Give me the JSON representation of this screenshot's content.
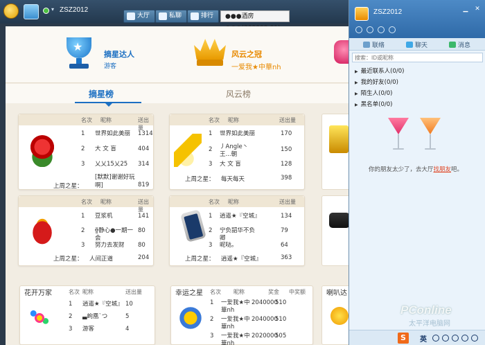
{
  "topbar": {
    "username": "ZSZ2012",
    "nav": {
      "hall": "大厅",
      "chat": "私聊",
      "rank": "排行"
    },
    "room": "●●●酒房●●●(209009-01)"
  },
  "hero": {
    "title1": "摘星达人",
    "sub1": "游客",
    "title2": "风云之冠",
    "sub2": "一爱我★中華nh"
  },
  "tabs": {
    "star": "摘星榜",
    "wind": "风云榜"
  },
  "headers": {
    "rank": "名次",
    "nick": "昵称",
    "out": "送出量",
    "award": "奖金",
    "win": "中奖额"
  },
  "prev_label": "上周之星：",
  "cards": [
    {
      "rows": [
        {
          "rank": "1",
          "nick": "世界如此美丽",
          "val": "1314"
        },
        {
          "rank": "2",
          "nick": "大 文 盲",
          "val": "404"
        },
        {
          "rank": "3",
          "nick": "乂乂15乂25",
          "val": "314"
        }
      ],
      "prev_nick": "[默默]谢谢好玩啊]",
      "prev_val": "819"
    },
    {
      "rows": [
        {
          "rank": "1",
          "nick": "世界如此美丽",
          "val": "170"
        },
        {
          "rank": "2",
          "nick": "丿Angle丶王...朝",
          "val": "150"
        },
        {
          "rank": "3",
          "nick": "大 文 盲",
          "val": "128"
        }
      ],
      "prev_nick": "每天每天",
      "prev_val": "398"
    },
    {
      "rows": [
        {
          "rank": "1",
          "nick": "豆浆机",
          "val": "141"
        },
        {
          "rank": "2",
          "nick": "╬静心●一期一会",
          "val": "80"
        },
        {
          "rank": "3",
          "nick": "努力去发财",
          "val": "80"
        }
      ],
      "prev_nick": "人间正道",
      "prev_val": "204"
    },
    {
      "rows": [
        {
          "rank": "1",
          "nick": "逍遥★『空城』",
          "val": "134"
        },
        {
          "rank": "2",
          "nick": "宁负韶华不负卿",
          "val": "79"
        },
        {
          "rank": "3",
          "nick": "昵哒。",
          "val": "64"
        }
      ],
      "prev_nick": "逍遥★『空城』",
      "prev_val": "363"
    },
    {
      "title": "花开万家",
      "rows": [
        {
          "rank": "1",
          "nick": "逍遥★『空城』",
          "val": "10"
        },
        {
          "rank": "2",
          "nick": "▃岣凰ˋつ",
          "val": "5"
        },
        {
          "rank": "3",
          "nick": "游客",
          "val": "4"
        }
      ]
    },
    {
      "title": "幸运之星",
      "rows": [
        {
          "rank": "1",
          "nick": "一爱我★中華nh",
          "val": "2040000",
          "val2": "510"
        },
        {
          "rank": "2",
          "nick": "一爱我★中華nh",
          "val": "2040000",
          "val2": "510"
        },
        {
          "rank": "3",
          "nick": "一爱我★中華nh",
          "val": "2020000",
          "val2": "505"
        }
      ]
    },
    {
      "title": "喇叭达"
    }
  ],
  "im": {
    "name": "ZSZ2012",
    "tabs": {
      "contacts": "联络",
      "chat": "聊天",
      "msg": "消息"
    },
    "search_placeholder": "搜索：ID或昵称",
    "groups": [
      "最近联系人(0/0)",
      "我的好友(0/0)",
      "陌生人(0/0)",
      "黑名单(0/0)"
    ],
    "tip_prefix": "你的朋友太少了，去大厅",
    "tip_link": "找朋友",
    "tip_suffix": "吧。",
    "ime_lang": "英"
  },
  "watermark": {
    "main": "PConline",
    "sub": "太平洋电脑网"
  },
  "colors": {
    "accent_blue": "#1b6fc2",
    "accent_orange": "#e88a00",
    "link": "#e04a2a"
  }
}
